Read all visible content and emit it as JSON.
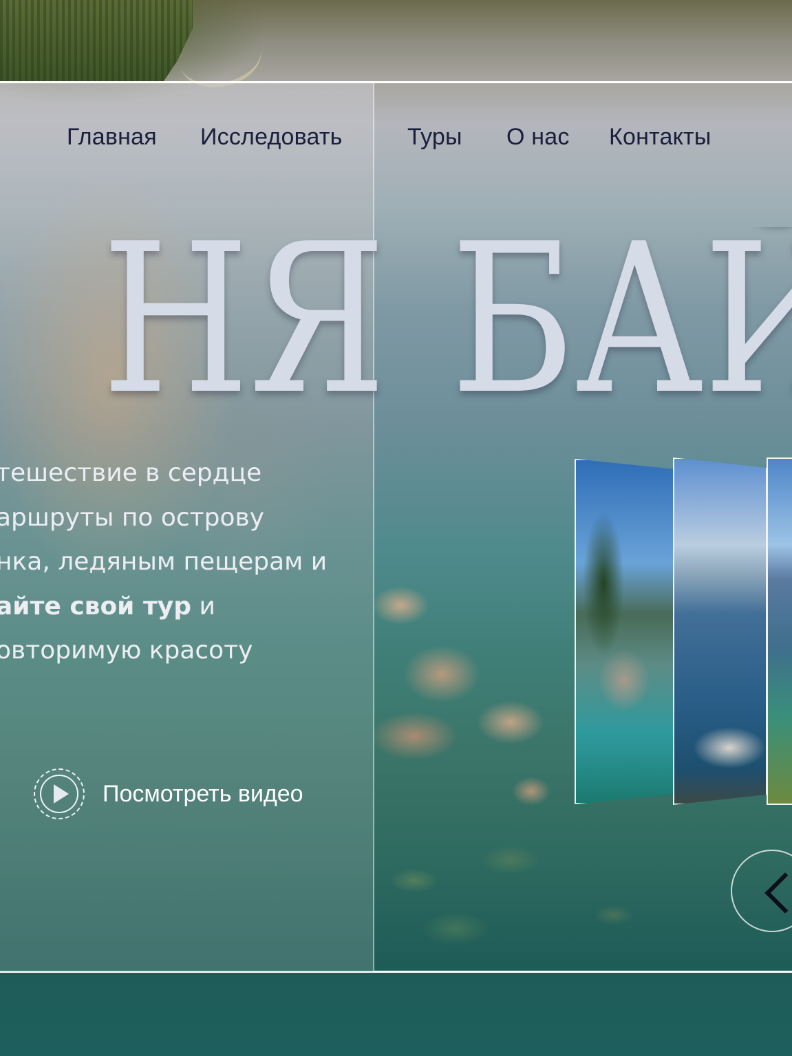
{
  "nav": {
    "items": [
      {
        "label": "Главная"
      },
      {
        "label": "Исследовать"
      },
      {
        "label": "Туры"
      },
      {
        "label": "О нас"
      },
      {
        "label": "Контакты"
      }
    ]
  },
  "hero": {
    "title_left": "НЯ",
    "title_right": "БАЙ",
    "description_lines": [
      "тешествие в сердце",
      "аршруты по острову",
      "нка, ледяным пещерам и",
      "айте свой тур",
      "и",
      "овторимую красоту"
    ],
    "video_label": "Посмотреть видео"
  },
  "icons": {
    "play": "play-icon",
    "prev": "chevron-left-icon"
  },
  "colors": {
    "nav_text": "#1a1f3d",
    "title_text": "#d6dbe8",
    "frame_border": "#ffffff"
  }
}
